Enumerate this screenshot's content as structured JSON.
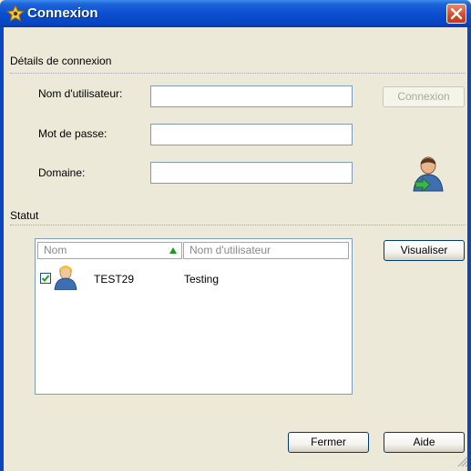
{
  "window": {
    "title": "Connexion"
  },
  "details": {
    "section_label": "Détails de connexion",
    "username_label": "Nom d'utilisateur:",
    "username_value": "",
    "password_label": "Mot de passe:",
    "password_value": "",
    "domain_label": "Domaine:",
    "domain_value": "",
    "connect_button": "Connexion"
  },
  "status": {
    "section_label": "Statut",
    "columns": [
      "Nom",
      "Nom d'utilisateur"
    ],
    "rows": [
      {
        "name": "TEST29",
        "username": "Testing",
        "checked": true
      }
    ],
    "view_button": "Visualiser"
  },
  "footer": {
    "close_button": "Fermer",
    "help_button": "Aide"
  },
  "colors": {
    "titlebar": "#0a4fd0",
    "background": "#ece9d8",
    "close": "#d4492a"
  }
}
